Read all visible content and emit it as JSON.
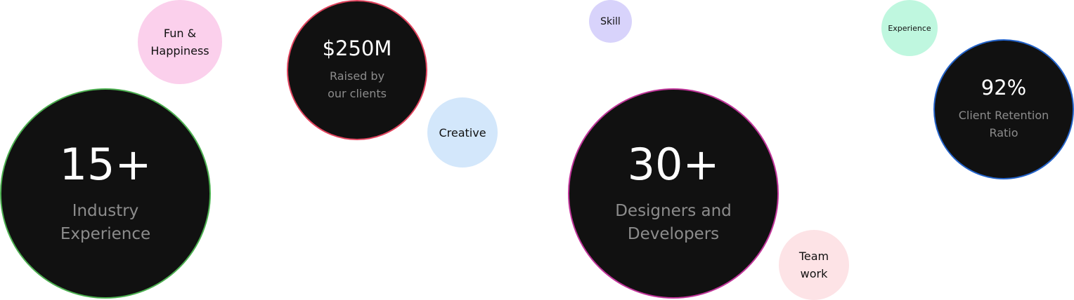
{
  "stats": {
    "industry": {
      "value": "15+",
      "label_line1": "Industry",
      "label_line2": "Experience",
      "color": "#4caf50"
    },
    "raised": {
      "value": "$250M",
      "label_line1": "Raised by",
      "label_line2": "our clients",
      "color": "#e0445e"
    },
    "team": {
      "value": "30+",
      "label_line1": "Designers and",
      "label_line2": "Developers",
      "color": "#c0359a"
    },
    "retention": {
      "value": "92%",
      "label_line1": "Client Retention",
      "label_line2": "Ratio",
      "color": "#2463c9"
    }
  },
  "tags": {
    "fun": {
      "line1": "Fun &",
      "line2": "Happiness",
      "color": "#fbd0ec"
    },
    "creative": {
      "label": "Creative",
      "color": "#d3e7fb"
    },
    "skill": {
      "label": "Skill",
      "color": "#d8d3fb"
    },
    "teamwork": {
      "line1": "Team",
      "line2": "work",
      "color": "#fde3e6"
    },
    "experience": {
      "label": "Experience",
      "color": "#bff7df"
    }
  },
  "theme": {
    "bubble_fill": "#111111",
    "value_color": "#ffffff",
    "label_color": "#8c8c8c"
  }
}
